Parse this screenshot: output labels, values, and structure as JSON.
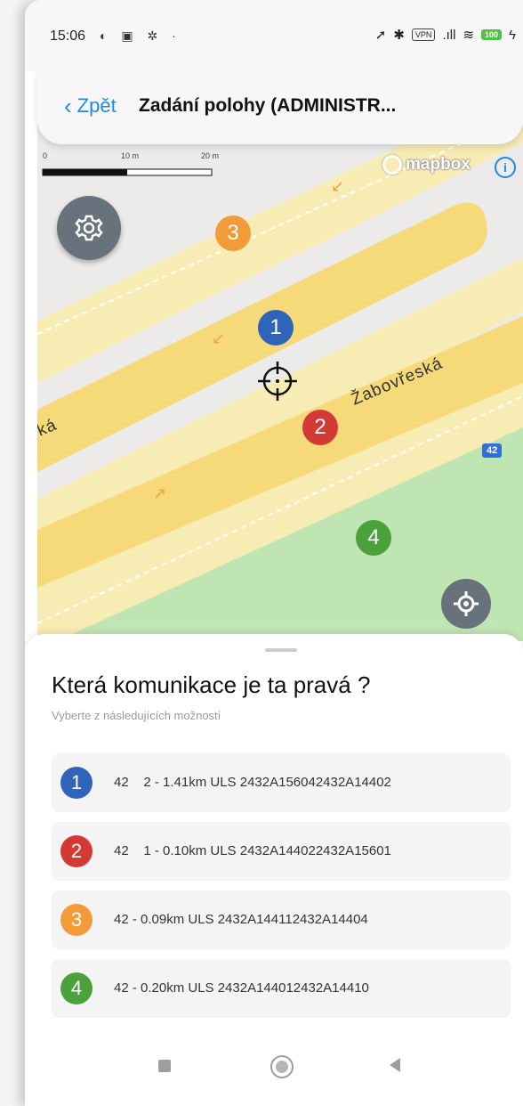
{
  "status_bar": {
    "time": "15:06",
    "vpn": "VPN",
    "battery": "100"
  },
  "header": {
    "back_label": "Zpět",
    "title": "Zadání polohy (ADMINISTR..."
  },
  "map": {
    "scale_labels": [
      "0",
      "10 m",
      "20 m"
    ],
    "attribution": "mapbox",
    "street_labels": [
      "Žabovřeská",
      "ká"
    ],
    "route_shield": "42",
    "markers": [
      {
        "label": "1",
        "color": "#2f64b8"
      },
      {
        "label": "2",
        "color": "#d33a35"
      },
      {
        "label": "3",
        "color": "#f29b38"
      },
      {
        "label": "4",
        "color": "#4ba23c"
      }
    ],
    "colors": {
      "background": "#ecebea",
      "road_main": "#f6da7a",
      "road_light": "#f7ecb4",
      "park": "#bfe5b2",
      "button": "#68727c"
    }
  },
  "sheet": {
    "question": "Která komunikace je ta pravá ?",
    "subtitle": "Vyberte z následujících možností",
    "options": [
      {
        "badge": "1",
        "text": "42    2 - 1.41km ULS 2432A156042432A14402",
        "color": "#2f64b8"
      },
      {
        "badge": "2",
        "text": "42    1 - 0.10km ULS 2432A144022432A15601",
        "color": "#d33a35"
      },
      {
        "badge": "3",
        "text": "42 - 0.09km ULS 2432A144112432A14404",
        "color": "#f29b38"
      },
      {
        "badge": "4",
        "text": "42 - 0.20km ULS 2432A144012432A14410",
        "color": "#4ba23c"
      }
    ]
  }
}
